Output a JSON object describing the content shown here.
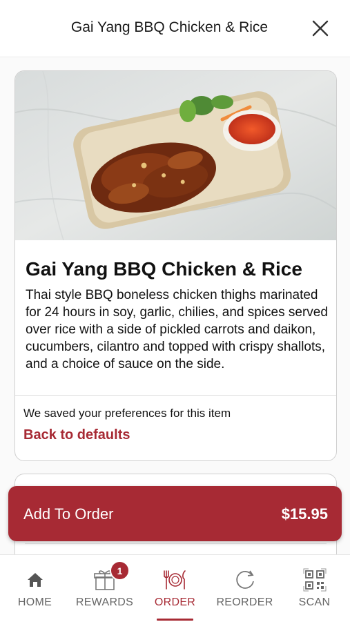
{
  "header": {
    "title": "Gai Yang BBQ Chicken & Rice"
  },
  "item": {
    "name": "Gai Yang BBQ Chicken & Rice",
    "description": "Thai style BBQ boneless chicken thighs marinated for 24 hours in soy, garlic, chilies, and spices served over rice with a side of pickled carrots and daikon, cucumbers, cilantro and topped with crispy shallots, and a choice of sauce on the side.",
    "preferences_note": "We saved your preferences for this item",
    "back_to_defaults": "Back to defaults"
  },
  "order_button": {
    "label": "Add To Order",
    "price": "$15.95"
  },
  "bottom_nav": {
    "items": [
      {
        "label": "HOME",
        "icon": "home-icon"
      },
      {
        "label": "REWARDS",
        "icon": "gift-icon",
        "badge": "1"
      },
      {
        "label": "ORDER",
        "icon": "utensils-icon",
        "active": true
      },
      {
        "label": "REORDER",
        "icon": "reorder-icon"
      },
      {
        "label": "SCAN",
        "icon": "qr-code-icon"
      }
    ]
  },
  "colors": {
    "accent": "#a72a34",
    "nav_inactive": "#666666"
  }
}
